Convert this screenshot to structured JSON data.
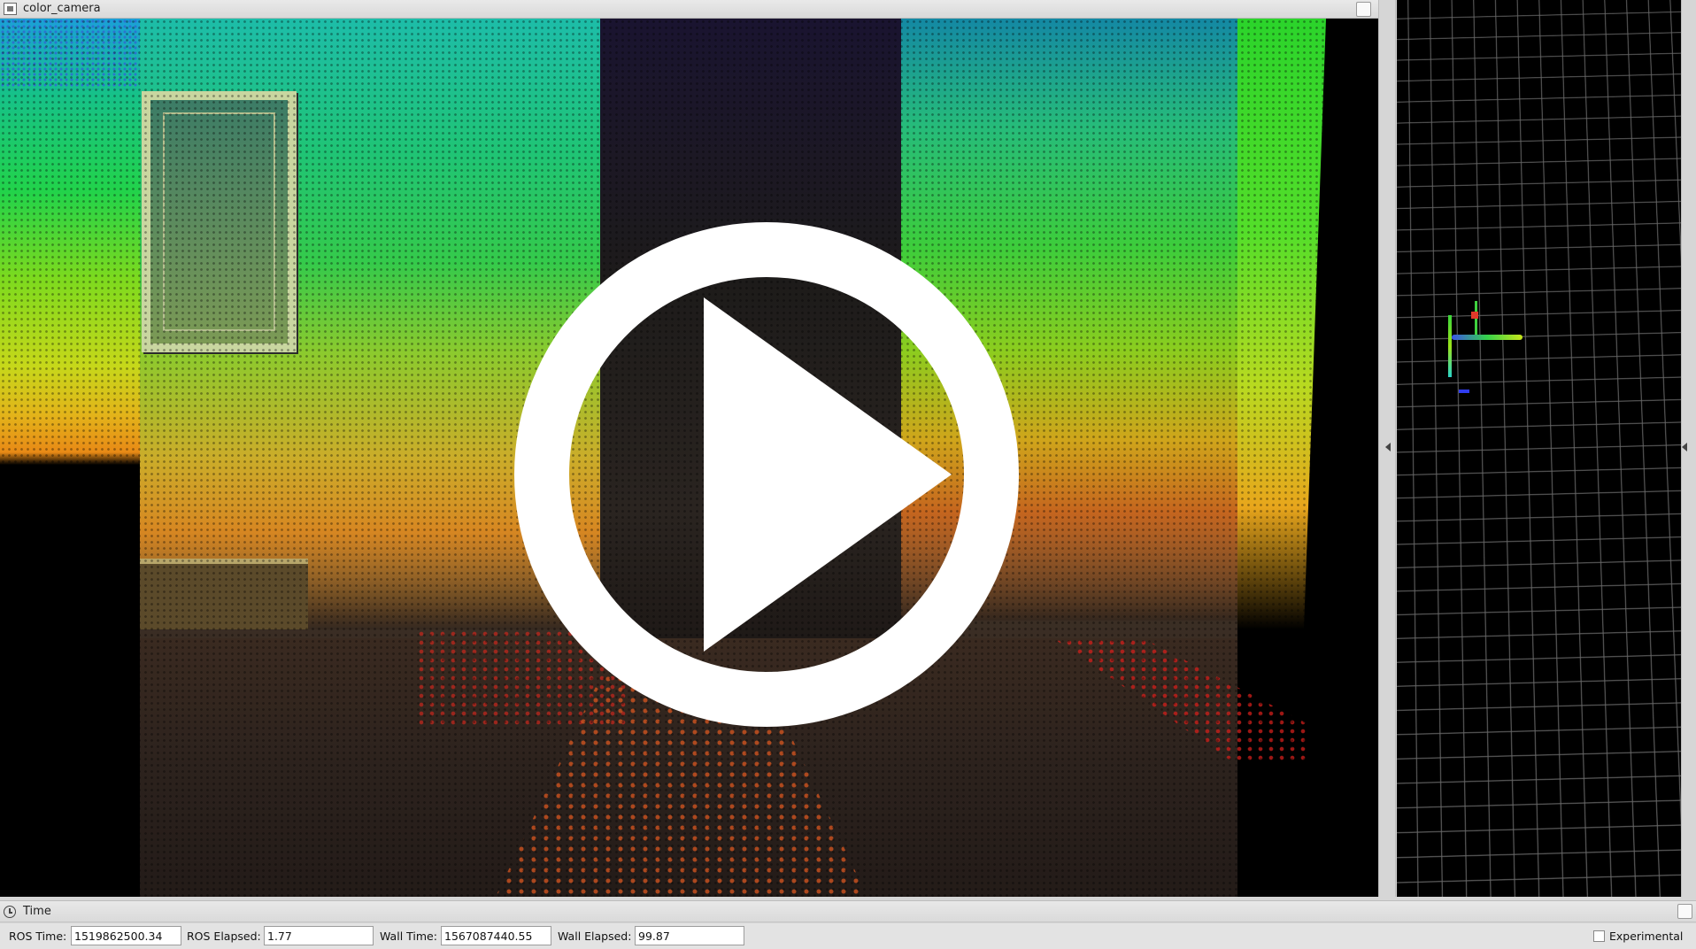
{
  "camera_panel": {
    "title": "color_camera",
    "icons": {
      "window": "image-window-icon",
      "close": "close-box-icon",
      "play": "play-icon"
    }
  },
  "view3d": {
    "icons": {
      "collapse": "collapse-arrow-icon"
    }
  },
  "time_panel": {
    "title": "Time",
    "icons": {
      "clock": "clock-icon",
      "close": "close-box-icon"
    },
    "fields": {
      "ros_time_label": "ROS Time:",
      "ros_time_value": "1519862500.34",
      "ros_elapsed_label": "ROS Elapsed:",
      "ros_elapsed_value": "1.77",
      "wall_time_label": "Wall Time:",
      "wall_time_value": "1567087440.55",
      "wall_elapsed_label": "Wall Elapsed:",
      "wall_elapsed_value": "99.87"
    },
    "experimental_label": "Experimental",
    "experimental_checked": false
  },
  "colors": {
    "panel_bg": "#d6d6d6",
    "view_bg": "#000000",
    "grid": "#7a7a7a",
    "play_overlay": "#ffffff"
  }
}
